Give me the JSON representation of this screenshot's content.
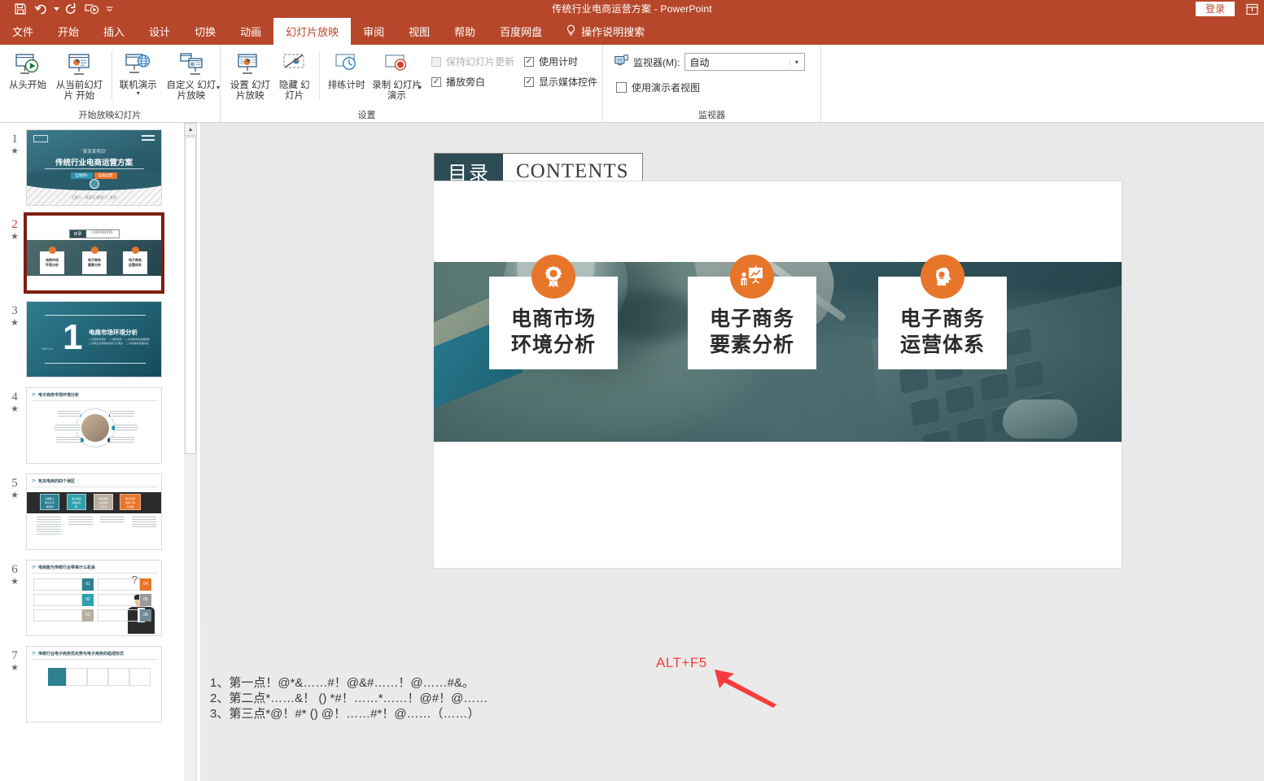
{
  "window": {
    "title": "传统行业电商运营方案  -  PowerPoint",
    "login_label": "登录",
    "ribbon_display_icon": "ribbon-display-options-icon"
  },
  "quick_access": [
    {
      "name": "save-icon",
      "label": "保存"
    },
    {
      "name": "undo-icon",
      "label": "撤消"
    },
    {
      "name": "redo-icon",
      "label": "恢复"
    },
    {
      "name": "start-from-beginning-icon",
      "label": "从头开始"
    },
    {
      "name": "customize-qat-caret-icon",
      "label": "自定义快速访问工具栏"
    }
  ],
  "tabs": [
    {
      "label": "文件",
      "active": false
    },
    {
      "label": "开始",
      "active": false
    },
    {
      "label": "插入",
      "active": false
    },
    {
      "label": "设计",
      "active": false
    },
    {
      "label": "切换",
      "active": false
    },
    {
      "label": "动画",
      "active": false
    },
    {
      "label": "幻灯片放映",
      "active": true
    },
    {
      "label": "审阅",
      "active": false
    },
    {
      "label": "视图",
      "active": false
    },
    {
      "label": "帮助",
      "active": false
    },
    {
      "label": "百度网盘",
      "active": false
    }
  ],
  "tell_me": {
    "label": "操作说明搜索",
    "icon": "lightbulb-icon"
  },
  "ribbon": {
    "groups": [
      {
        "label": "开始放映幻灯片",
        "buttons": [
          {
            "label": "从头开始",
            "icon": "slideshow-play-icon"
          },
          {
            "label": "从当前幻灯片\n开始",
            "icon": "slideshow-current-icon"
          },
          {
            "label": "联机演示",
            "icon": "present-online-icon",
            "has_caret": true
          },
          {
            "label": "自定义\n幻灯片放映",
            "icon": "custom-slideshow-icon",
            "has_caret": true
          }
        ]
      },
      {
        "label": "设置",
        "buttons": [
          {
            "label": "设置\n幻灯片放映",
            "icon": "setup-slideshow-icon"
          },
          {
            "label": "隐藏\n幻灯片",
            "icon": "hide-slide-icon"
          },
          {
            "label": "排练计时",
            "icon": "rehearse-timings-icon"
          },
          {
            "label": "录制\n幻灯片演示",
            "icon": "record-slideshow-icon",
            "has_caret": true
          }
        ],
        "checkboxes": [
          {
            "label": "保持幻灯片更新",
            "checked": false,
            "disabled": true
          },
          {
            "label": "使用计时",
            "checked": true,
            "disabled": false
          },
          {
            "label": "播放旁白",
            "checked": true,
            "disabled": false
          },
          {
            "label": "显示媒体控件",
            "checked": true,
            "disabled": false
          }
        ]
      },
      {
        "label": "监视器",
        "monitor_label": "监视器(M):",
        "monitor_value": "自动",
        "monitor_icon": "monitor-icon",
        "presenter_view": {
          "label": "使用演示者视图",
          "checked": false
        }
      }
    ]
  },
  "thumbnails": {
    "scroll_up_icon": "scroll-up-arrow-icon",
    "slides": [
      {
        "number": "1",
        "star": "★",
        "selected": false,
        "kind": "cover",
        "cover": {
          "quote": "\"某某某项目\"",
          "title": "传统行业电商运营方案",
          "pill1": "互联网+",
          "pill2": "电商运营",
          "footer": "汇报人：某某/汇报部门：某部"
        }
      },
      {
        "number": "2",
        "star": "★",
        "selected": true,
        "kind": "contents",
        "contents": {
          "tag_cn": "目录",
          "tag_en": "CONTENTS",
          "cards": [
            "电商市场\n环境分析",
            "电子商务\n要素分析",
            "电子商务\n运营体系"
          ]
        }
      },
      {
        "number": "3",
        "star": "★",
        "selected": false,
        "kind": "section",
        "section": {
          "num": "1",
          "title": "电商市场环境分析",
          "part": "PART 01",
          "bullets": [
            "中国电商现状",
            "全球电商的发展趋势",
            "中国电商发展阶段",
            "电商优势",
            "传统企业转型电商的几大难点"
          ]
        }
      },
      {
        "number": "4",
        "star": "★",
        "selected": false,
        "kind": "circle",
        "circle": {
          "title": "电子商务市场环境分析"
        }
      },
      {
        "number": "5",
        "star": "★",
        "selected": false,
        "kind": "fourcol",
        "fourcol": {
          "title": "有关电商的四个误区",
          "cards": [
            "只做网上\n电子才叫\n电商吗",
            "电子商务\n就是\"网\n购\"",
            "电商网站\n只是电商\n的平台",
            "电子商务\n就是个体\n户的事"
          ]
        }
      },
      {
        "number": "6",
        "star": "★",
        "selected": false,
        "kind": "sixbox",
        "sixbox": {
          "title": "电商能为传统行业带来什么机会",
          "badges": [
            "01",
            "02",
            "03",
            "04",
            "05",
            "06"
          ]
        }
      },
      {
        "number": "7",
        "star": "★",
        "selected": false,
        "kind": "table",
        "table": {
          "title": "传统行业电子商务优劣势与电子商务的组成形式"
        }
      }
    ]
  },
  "slide": {
    "tag_cn": "目录",
    "tag_en": "CONTENTS",
    "cards": [
      {
        "icon": "award-ribbon-icon",
        "text": "电商市场\n环境分析"
      },
      {
        "icon": "presentation-chart-icon",
        "text": "电子商务\n要素分析"
      },
      {
        "icon": "head-idea-icon",
        "text": "电子商务\n运营体系"
      }
    ]
  },
  "notes": {
    "text": "1、第一点！@*&……#！@&#……！@……#&。\n2、第二点*……&！  ()  *#！……*……！@#！@……\n3、第三点*@！#*  ()  @！……#*！@……（……）"
  },
  "annotation": {
    "label": "ALT+F5",
    "color": "#fa3c3c",
    "arrow_icon": "red-arrow-icon"
  },
  "colors": {
    "brand_red": "#b7472a",
    "accent_orange": "#e8762a",
    "teal_dark": "#2d4c56",
    "selected_border": "#7d1e12"
  }
}
